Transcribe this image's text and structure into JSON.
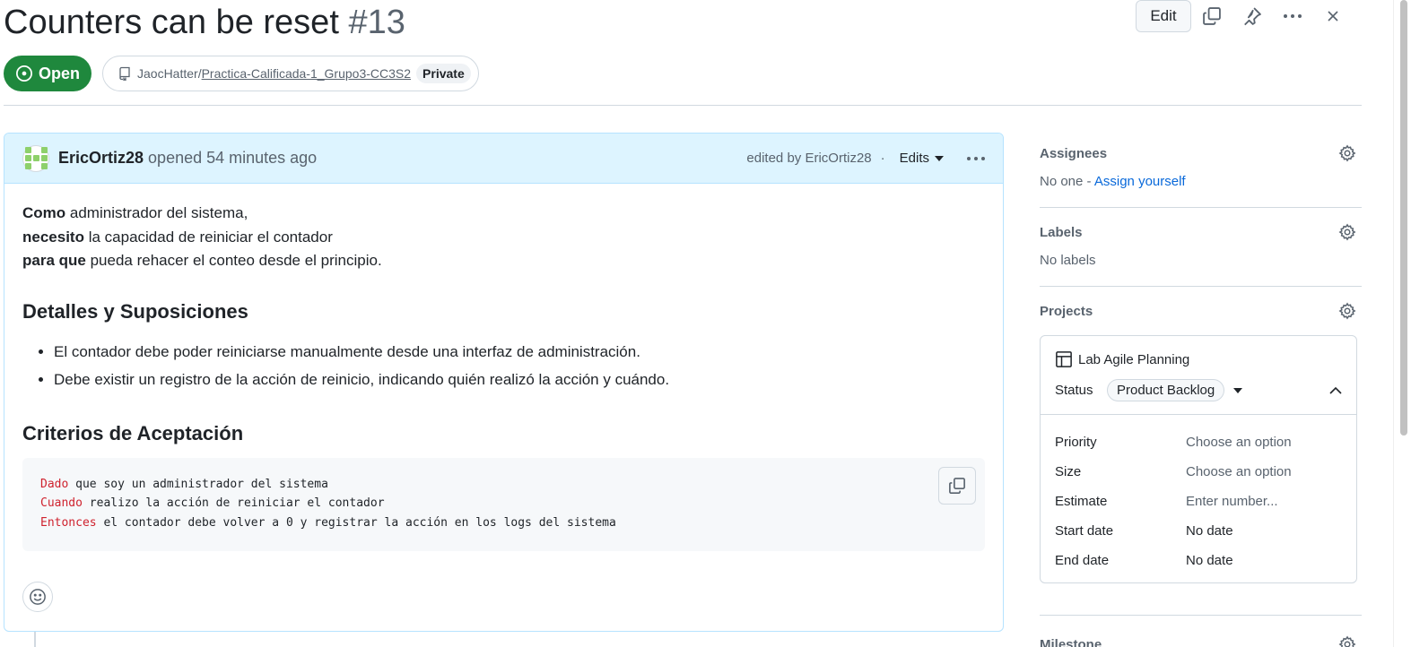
{
  "issue": {
    "title": "Counters can be reset",
    "number": "#13",
    "state": "Open",
    "repo_owner": "JaocHatter/",
    "repo_name": "Practica-Calificada-1_Grupo3-CC3S2",
    "visibility": "Private"
  },
  "top_actions": {
    "edit_label": "Edit"
  },
  "comment": {
    "author": "EricOrtiz28",
    "opened_text": "opened 54 minutes ago",
    "edited_text": "edited by EricOrtiz28",
    "separator": "·",
    "edits_label": "Edits",
    "story": [
      {
        "bold": "Como",
        "rest": " administrador del sistema,"
      },
      {
        "bold": "necesito",
        "rest": " la capacidad de reiniciar el contador"
      },
      {
        "bold": "para que",
        "rest": " pueda rehacer el conteo desde el principio."
      }
    ],
    "section1_title": "Detalles y Suposiciones",
    "bullets": [
      "El contador debe poder reiniciarse manualmente desde una interfaz de administración.",
      "Debe existir un registro de la acción de reinicio, indicando quién realizó la acción y cuándo."
    ],
    "section2_title": "Criterios de Aceptación",
    "code": [
      {
        "kw": "Dado",
        "rest": " que soy un administrador del sistema"
      },
      {
        "kw": "Cuando",
        "rest": " realizo la acción de reiniciar el contador"
      },
      {
        "kw": "Entonces",
        "rest": " el contador debe volver a 0 y registrar la acción en los logs del sistema"
      }
    ]
  },
  "sidebar": {
    "assignees_title": "Assignees",
    "assignees_none": "No one - ",
    "assign_yourself": "Assign yourself",
    "labels_title": "Labels",
    "labels_value": "No labels",
    "projects_title": "Projects",
    "project_name": "Lab Agile Planning",
    "status_label": "Status",
    "status_value": "Product Backlog",
    "fields": [
      {
        "label": "Priority",
        "value": "Choose an option"
      },
      {
        "label": "Size",
        "value": "Choose an option"
      },
      {
        "label": "Estimate",
        "value": "Enter number..."
      },
      {
        "label": "Start date",
        "value": "No date"
      },
      {
        "label": "End date",
        "value": "No date"
      }
    ],
    "milestone_title": "Milestone"
  },
  "colors": {
    "open_green": "#1f883d",
    "header_blue": "#ddf4ff",
    "link_blue": "#0969da",
    "keyword_red": "#cf222e"
  },
  "icons": [
    "copy-icon",
    "pin-icon",
    "kebab-icon",
    "close-icon",
    "issue-open-icon",
    "repo-icon",
    "gear-icon",
    "table-icon",
    "triangle-down-icon",
    "chevron-up-icon",
    "smiley-icon"
  ]
}
